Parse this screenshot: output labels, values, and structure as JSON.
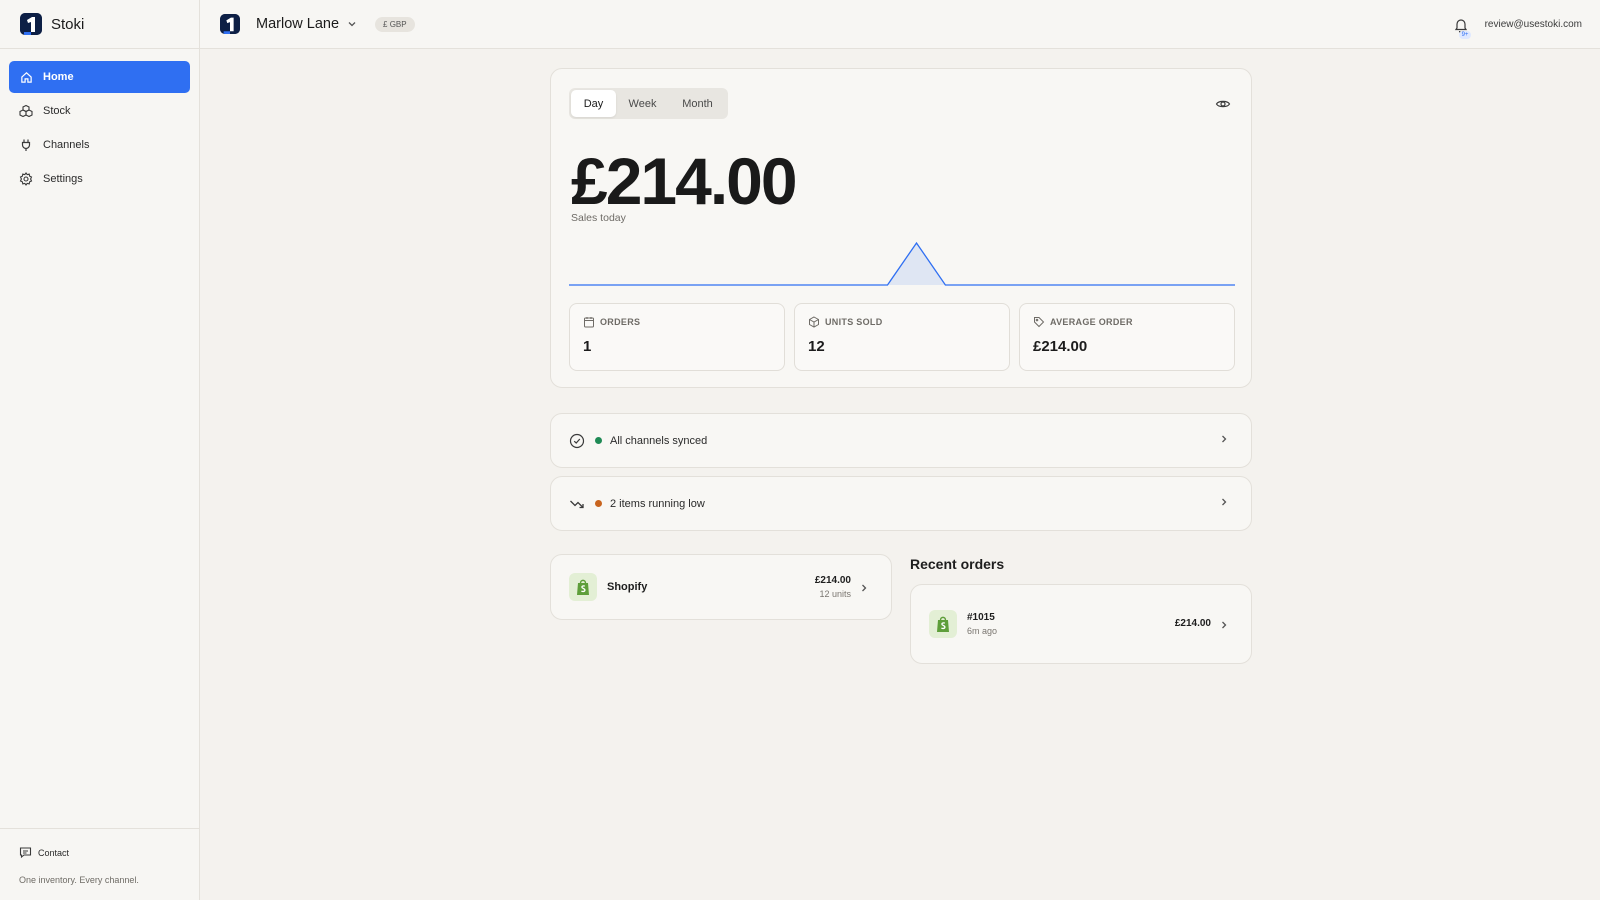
{
  "app": {
    "name": "Stoki",
    "brand_color": "#2f6ff2",
    "dark_color": "#0d1f45"
  },
  "sidebar": {
    "items": [
      {
        "label": "Home",
        "icon": "home-icon",
        "active": true
      },
      {
        "label": "Stock",
        "icon": "stock-icon",
        "active": false
      },
      {
        "label": "Channels",
        "icon": "plug-icon",
        "active": false
      },
      {
        "label": "Settings",
        "icon": "gear-icon",
        "active": false
      }
    ],
    "footer": {
      "contact": "Contact",
      "tagline": "One inventory. Every channel."
    }
  },
  "topbar": {
    "store_name": "Marlow Lane",
    "currency": "£ GBP",
    "notification_badge": "9+",
    "email": "review@usestoki.com"
  },
  "sales": {
    "tabs": [
      "Day",
      "Week",
      "Month"
    ],
    "active_tab": "Day",
    "amount": "£214.00",
    "label": "Sales today",
    "sparkline_color": "#2f6ff2",
    "sparkline_points": [
      0,
      0,
      0,
      0,
      0,
      0,
      0,
      0,
      0,
      0,
      0,
      0,
      1,
      0,
      0,
      0,
      0,
      0,
      0,
      0,
      0,
      0,
      0,
      0
    ]
  },
  "stats": [
    {
      "label": "ORDERS",
      "value": "1",
      "icon": "calendar-icon"
    },
    {
      "label": "UNITS SOLD",
      "value": "12",
      "icon": "package-icon"
    },
    {
      "label": "AVERAGE ORDER",
      "value": "£214.00",
      "icon": "tag-icon"
    }
  ],
  "status": [
    {
      "text": "All channels synced",
      "dot_color": "#1f8a55",
      "icon": "check-circle-icon"
    },
    {
      "text": "2 items running low",
      "dot_color": "#c8641e",
      "icon": "trending-down-icon"
    }
  ],
  "channel": {
    "name": "Shopify",
    "amount": "£214.00",
    "units": "12 units",
    "icon": "shopify-icon"
  },
  "recent_orders": {
    "title": "Recent orders",
    "items": [
      {
        "id": "#1015",
        "time": "6m ago",
        "amount": "£214.00",
        "icon": "shopify-icon"
      }
    ]
  }
}
